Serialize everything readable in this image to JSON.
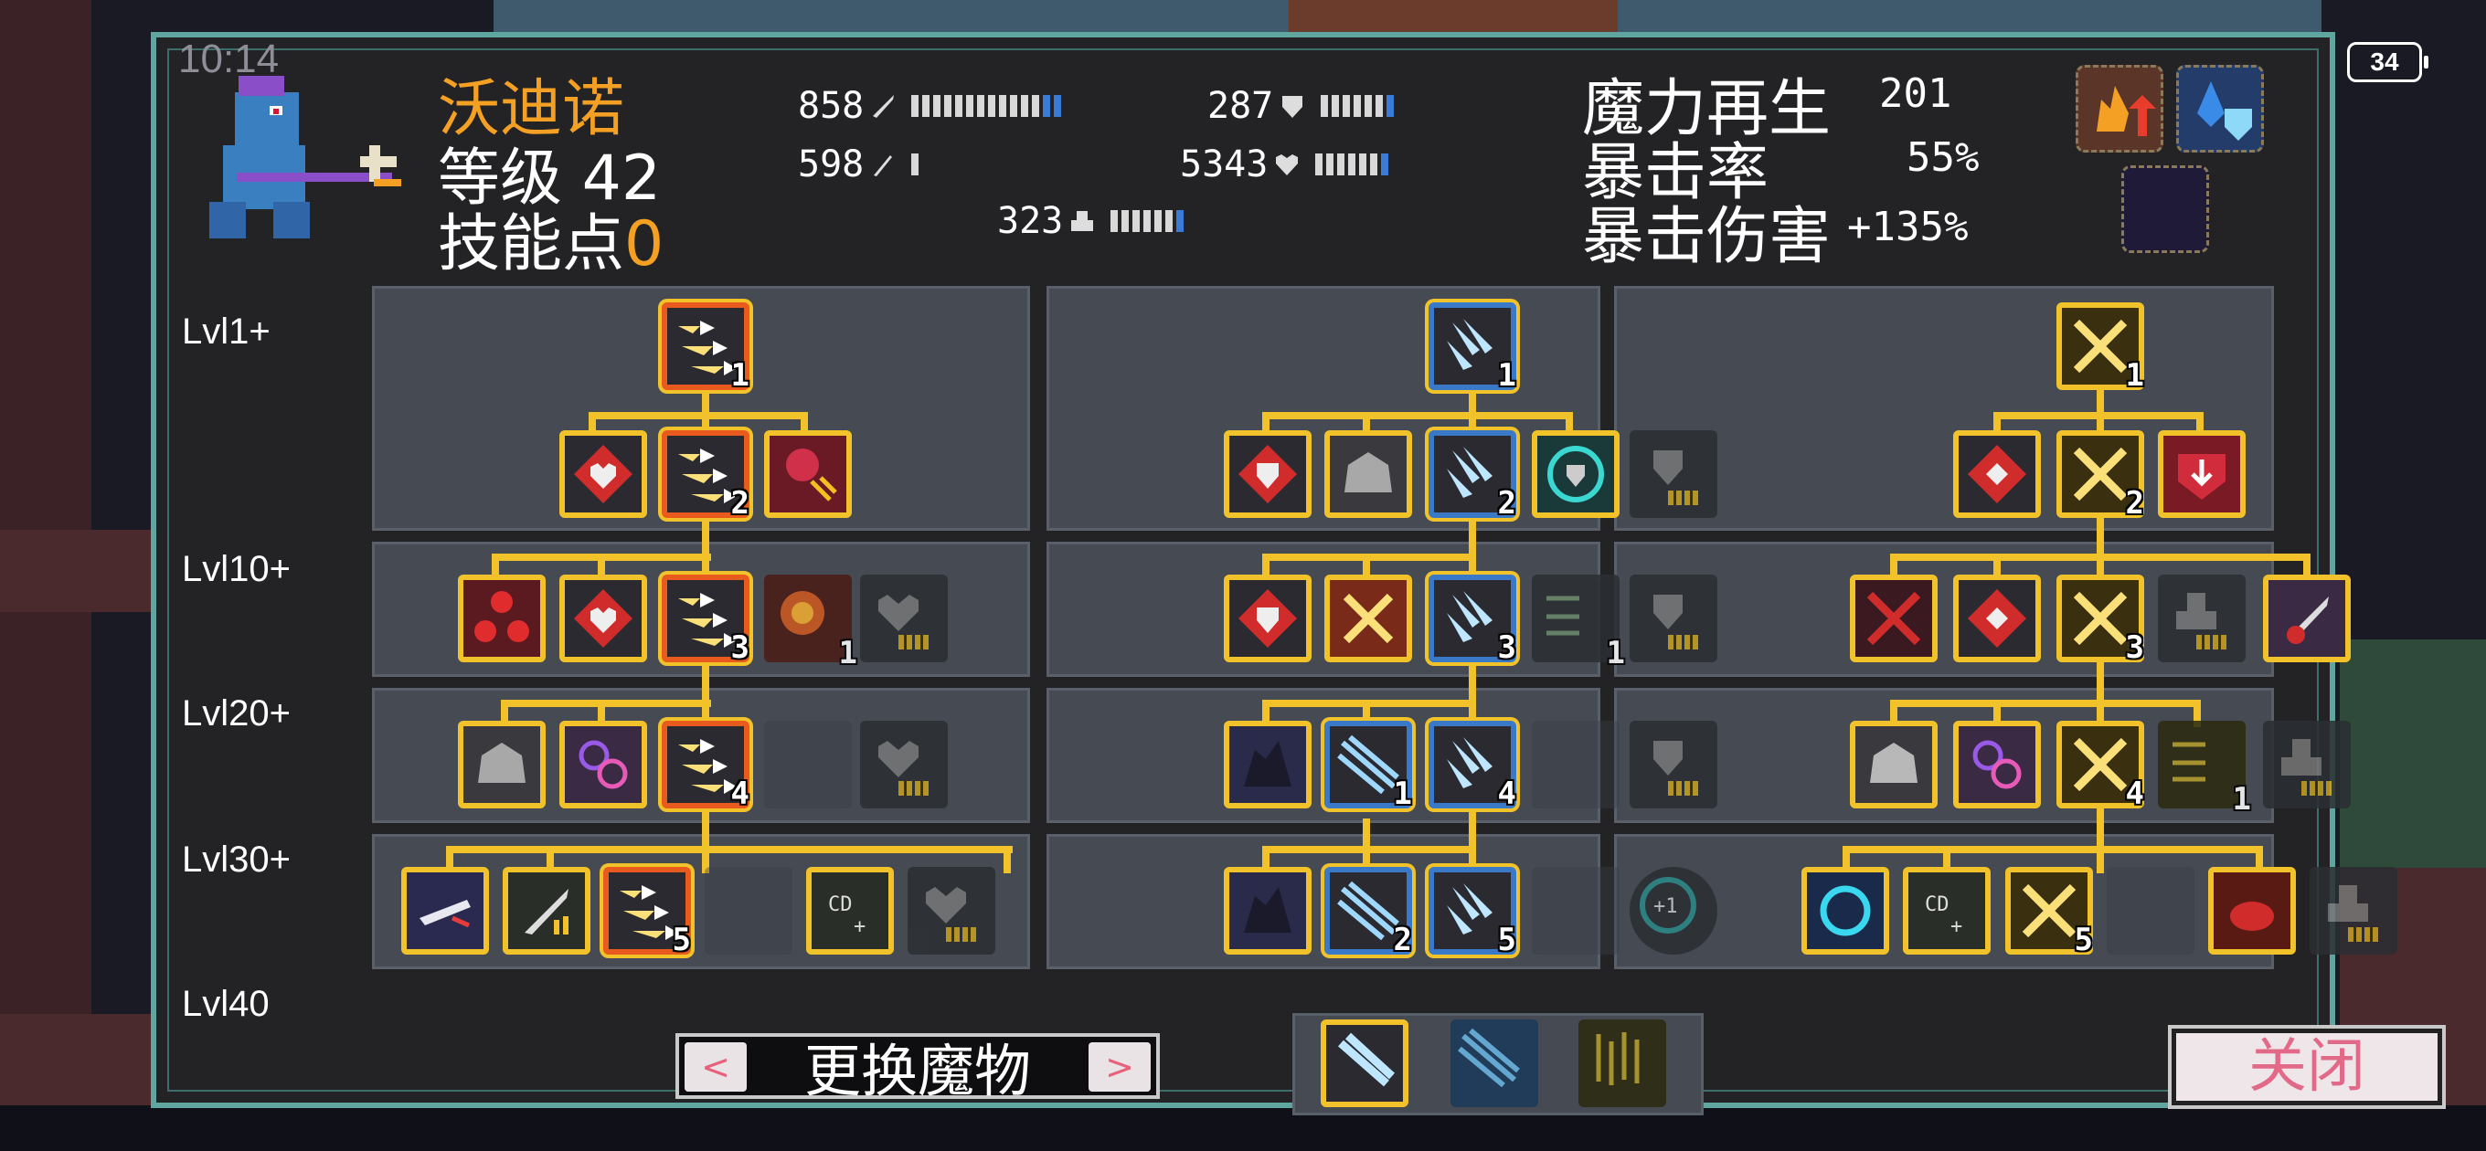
{
  "status": {
    "time": "10:14",
    "battery": "34"
  },
  "character": {
    "name": "沃迪诺",
    "level_label": "等级",
    "level": "42",
    "skill_points_label": "技能点",
    "skill_points": "0"
  },
  "stats": {
    "attack": "858",
    "magic": "598",
    "defense": "287",
    "health": "5343",
    "speed": "323",
    "mana_regen_label": "魔力再生",
    "mana_regen": "201",
    "crit_rate_label": "暴击率",
    "crit_rate": "55%",
    "crit_damage_label": "暴击伤害",
    "crit_damage": "+135%"
  },
  "levels": [
    "Lvl1+",
    "Lvl10+",
    "Lvl20+",
    "Lvl30+",
    "Lvl40"
  ],
  "buttons": {
    "change_monster": "更换魔物",
    "close": "关闭",
    "prev": "<",
    "next": ">"
  },
  "tree_left_ranks": [
    "1",
    "2",
    "3",
    "1",
    "4",
    "5"
  ],
  "tree_mid_ranks": [
    "1",
    "2",
    "3",
    "1",
    "1",
    "4",
    "2",
    "5"
  ],
  "tree_right_ranks": [
    "1",
    "2",
    "3",
    "4",
    "1",
    "5"
  ],
  "colors": {
    "accent": "#f4a024",
    "frame": "#f2c22a",
    "panel_border": "#5fa6a1",
    "close_text": "#e26a88"
  }
}
